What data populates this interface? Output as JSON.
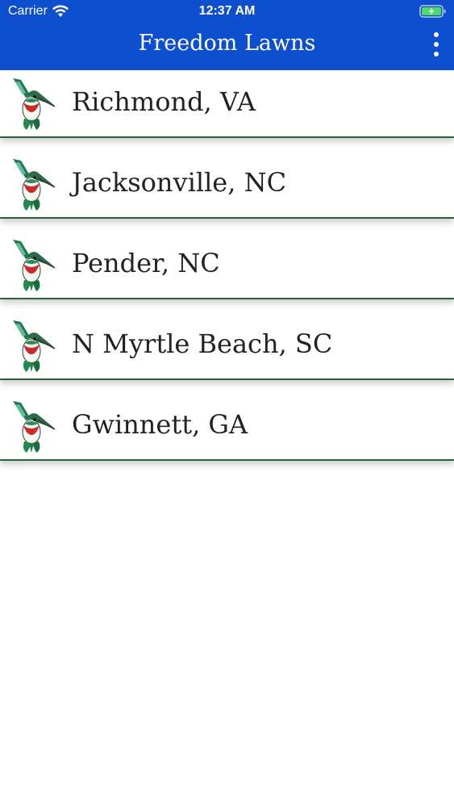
{
  "status_bar": {
    "carrier": "Carrier",
    "time": "12:37 AM",
    "wifi_icon": "wifi-icon",
    "battery_icon": "battery-charging-icon"
  },
  "header": {
    "title": "Freedom Lawns",
    "menu_icon": "more-vertical-icon",
    "background_color": "#0d4fcf"
  },
  "locations": [
    {
      "label": "Richmond, VA",
      "icon": "hummingbird-icon"
    },
    {
      "label": "Jacksonville, NC",
      "icon": "hummingbird-icon"
    },
    {
      "label": "Pender, NC",
      "icon": "hummingbird-icon"
    },
    {
      "label": "N Myrtle Beach, SC",
      "icon": "hummingbird-icon"
    },
    {
      "label": "Gwinnett, GA",
      "icon": "hummingbird-icon"
    }
  ]
}
